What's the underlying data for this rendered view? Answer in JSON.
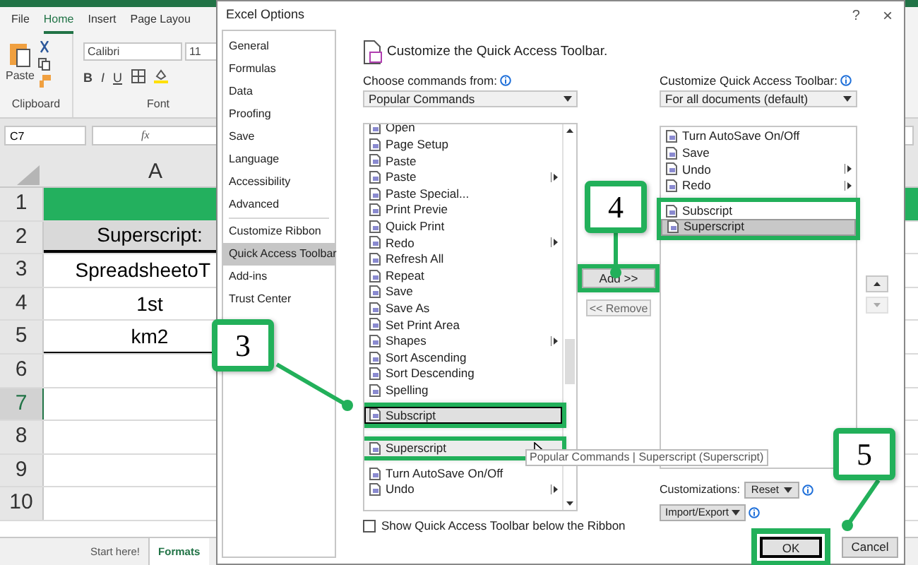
{
  "excel": {
    "ribbon_tabs": [
      {
        "label": "File",
        "selected": false
      },
      {
        "label": "Home",
        "selected": true
      },
      {
        "label": "Insert",
        "selected": false
      },
      {
        "label": "Page Layou",
        "selected": false
      }
    ],
    "paste_label": "Paste",
    "font_name": "Calibri",
    "font_size": "11",
    "format_buttons": [
      "B",
      "I",
      "U"
    ],
    "group_labels": [
      "Clipboard",
      "Font"
    ],
    "name_box": "C7",
    "formula_icon": "fx",
    "column_header": "A",
    "rows": [
      {
        "number": "1",
        "kind": "banner",
        "selected": false
      },
      {
        "number": "2",
        "kind": "label",
        "value": "Superscript:",
        "selected": false
      },
      {
        "number": "3",
        "kind": "data",
        "value": "SpreadsheetoT",
        "selected": false
      },
      {
        "number": "4",
        "kind": "data",
        "value": "1st",
        "selected": false
      },
      {
        "number": "5",
        "kind": "data",
        "value": "km2",
        "selected": false
      },
      {
        "number": "6",
        "kind": "data",
        "selected": false
      },
      {
        "number": "7",
        "kind": "data",
        "selected": true
      },
      {
        "number": "8",
        "kind": "data",
        "selected": false
      },
      {
        "number": "9",
        "kind": "data",
        "selected": false
      },
      {
        "number": "10",
        "kind": "data",
        "selected": false
      }
    ],
    "sheet_tabs": [
      {
        "label": "Start here!",
        "selected": false
      },
      {
        "label": "Formats",
        "selected": true
      }
    ]
  },
  "dialog": {
    "title": "Excel Options",
    "help": "?",
    "close": "×",
    "nav": [
      {
        "label": "General",
        "selected": false
      },
      {
        "label": "Formulas",
        "selected": false
      },
      {
        "label": "Data",
        "selected": false
      },
      {
        "label": "Proofing",
        "selected": false
      },
      {
        "label": "Save",
        "selected": false
      },
      {
        "label": "Language",
        "selected": false
      },
      {
        "label": "Accessibility",
        "selected": false
      },
      {
        "label": "Advanced",
        "selected": false
      },
      {
        "label": "Customize Ribbon",
        "selected": false
      },
      {
        "label": "Quick Access Toolbar",
        "selected": true
      },
      {
        "label": "Add-ins",
        "selected": false
      },
      {
        "label": "Trust Center",
        "selected": false
      }
    ],
    "heading": "Customize the Quick Access Toolbar.",
    "choose_label": "Choose commands from:",
    "choose_value": "Popular Commands",
    "commands": [
      {
        "label": "Open",
        "submenu": false,
        "selected": false,
        "highlighted": false,
        "hovered": false
      },
      {
        "label": "Page Setup",
        "submenu": false,
        "selected": false,
        "highlighted": false,
        "hovered": false
      },
      {
        "label": "Paste",
        "submenu": false,
        "selected": false,
        "highlighted": false,
        "hovered": false
      },
      {
        "label": "Paste",
        "submenu": true,
        "selected": false,
        "highlighted": false,
        "hovered": false
      },
      {
        "label": "Paste Special...",
        "submenu": false,
        "selected": false,
        "highlighted": false,
        "hovered": false
      },
      {
        "label": "Print Previe",
        "submenu": false,
        "selected": false,
        "highlighted": false,
        "hovered": false
      },
      {
        "label": "Quick Print",
        "submenu": false,
        "selected": false,
        "highlighted": false,
        "hovered": false
      },
      {
        "label": "Redo",
        "submenu": true,
        "selected": false,
        "highlighted": false,
        "hovered": false
      },
      {
        "label": "Refresh All",
        "submenu": false,
        "selected": false,
        "highlighted": false,
        "hovered": false
      },
      {
        "label": "Repeat",
        "submenu": false,
        "selected": false,
        "highlighted": false,
        "hovered": false
      },
      {
        "label": "Save",
        "submenu": false,
        "selected": false,
        "highlighted": false,
        "hovered": false
      },
      {
        "label": "Save As",
        "submenu": false,
        "selected": false,
        "highlighted": false,
        "hovered": false
      },
      {
        "label": "Set Print Area",
        "submenu": false,
        "selected": false,
        "highlighted": false,
        "hovered": false
      },
      {
        "label": "Shapes",
        "submenu": true,
        "selected": false,
        "highlighted": false,
        "hovered": false
      },
      {
        "label": "Sort Ascending",
        "submenu": false,
        "selected": false,
        "highlighted": false,
        "hovered": false
      },
      {
        "label": "Sort Descending",
        "submenu": false,
        "selected": false,
        "highlighted": false,
        "hovered": false
      },
      {
        "label": "Spelling",
        "submenu": false,
        "selected": false,
        "highlighted": false,
        "hovered": false
      },
      {
        "label": "Subscript",
        "submenu": false,
        "selected": true,
        "highlighted": true,
        "hovered": false
      },
      {
        "label": "Superscript",
        "submenu": false,
        "selected": false,
        "highlighted": true,
        "hovered": true
      },
      {
        "label": "Turn AutoSave On/Off",
        "submenu": false,
        "selected": false,
        "highlighted": false,
        "hovered": false
      },
      {
        "label": "Undo",
        "submenu": true,
        "selected": false,
        "highlighted": false,
        "hovered": false
      }
    ],
    "add_button": {
      "label": "Add >>",
      "highlighted": true
    },
    "remove_button": "<< Remove",
    "customize_label": "Customize Quick Access Toolbar:",
    "customize_value": "For all documents (default)",
    "toolbar_items": [
      {
        "label": "Turn AutoSave On/Off",
        "submenu": false,
        "selected": false,
        "highlighted": false
      },
      {
        "label": "Save",
        "submenu": false,
        "selected": false,
        "highlighted": false
      },
      {
        "label": "Undo",
        "submenu": true,
        "selected": false,
        "highlighted": false
      },
      {
        "label": "Redo",
        "submenu": true,
        "selected": false,
        "highlighted": false
      },
      {
        "label": "Subscript",
        "submenu": false,
        "selected": false,
        "highlighted": true
      },
      {
        "label": "Superscript",
        "submenu": false,
        "selected": true,
        "highlighted": true
      }
    ],
    "tooltip": "Popular Commands | Superscript (Superscript)",
    "show_below": {
      "label": "Show Quick Access Toolbar below the Ribbon",
      "checked": false
    },
    "customizations_label": "Customizations:",
    "reset": "Reset",
    "import_export": "Import/Export",
    "ok": {
      "label": "OK",
      "highlighted": true
    },
    "cancel": "Cancel"
  },
  "callouts": [
    {
      "number": "4"
    },
    {
      "number": "3"
    },
    {
      "number": "5"
    }
  ]
}
